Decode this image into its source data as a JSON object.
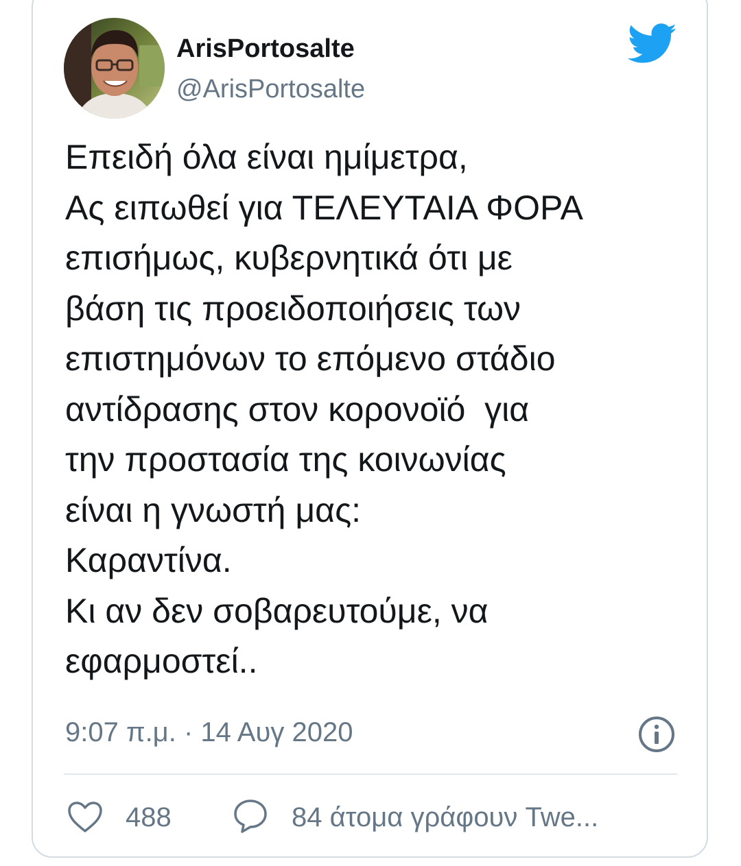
{
  "colors": {
    "text_primary": "#14171a",
    "text_secondary": "#657786",
    "twitter_blue": "#1da1f2",
    "border": "#d3dce2"
  },
  "author": {
    "name": "ArisPortosalte",
    "handle": "@ArisPortosalte",
    "avatar_icon": "profile-photo"
  },
  "tweet": {
    "lines": [
      "Επειδή όλα είναι ημίμετρα,",
      "Ας ειπωθεί για ΤΕΛΕΥΤΑΙΑ ΦΟΡΑ",
      "επισήμως, κυβερνητικά ότι με",
      "βάση τις προειδοποιήσεις των",
      "επιστημόνων το επόμενο στάδιο",
      "αντίδρασης στον κορονοϊό  για",
      "την προστασία της κοινωνίας",
      "είναι η γνωστή μας:",
      "Καραντίνα.",
      "Κι αν δεν σοβαρευτούμε, να",
      "εφαρμοστεί.."
    ],
    "timestamp": "9:07 π.μ. · 14 Αυγ 2020"
  },
  "actions": {
    "like_count": "488",
    "reply_text": "84 άτομα γράφουν Twe..."
  },
  "icons": {
    "brand": "twitter-bird-icon",
    "info": "info-icon",
    "like": "heart-icon",
    "reply": "speech-bubble-icon"
  }
}
